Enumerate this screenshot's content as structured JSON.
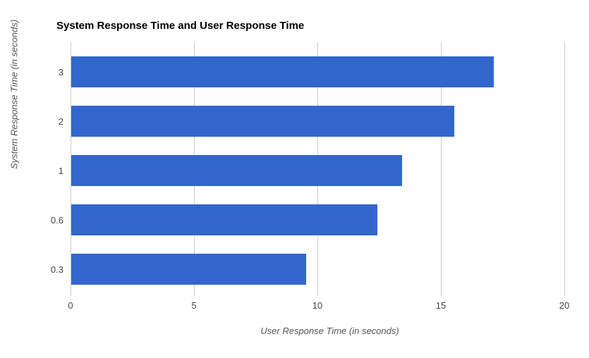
{
  "chart_data": {
    "type": "bar",
    "orientation": "horizontal",
    "title": "System Response Time and User Response Time",
    "xlabel": "User Response Time (in seconds)",
    "ylabel": "System Response Time (in seconds)",
    "categories": [
      "3",
      "2",
      "1",
      "0.6",
      "0.3"
    ],
    "values": [
      17.1,
      15.5,
      13.4,
      12.4,
      9.5
    ],
    "xlim": [
      0,
      20
    ],
    "xticks": [
      0,
      5,
      10,
      15,
      20
    ],
    "bar_color": "#3366cc"
  }
}
